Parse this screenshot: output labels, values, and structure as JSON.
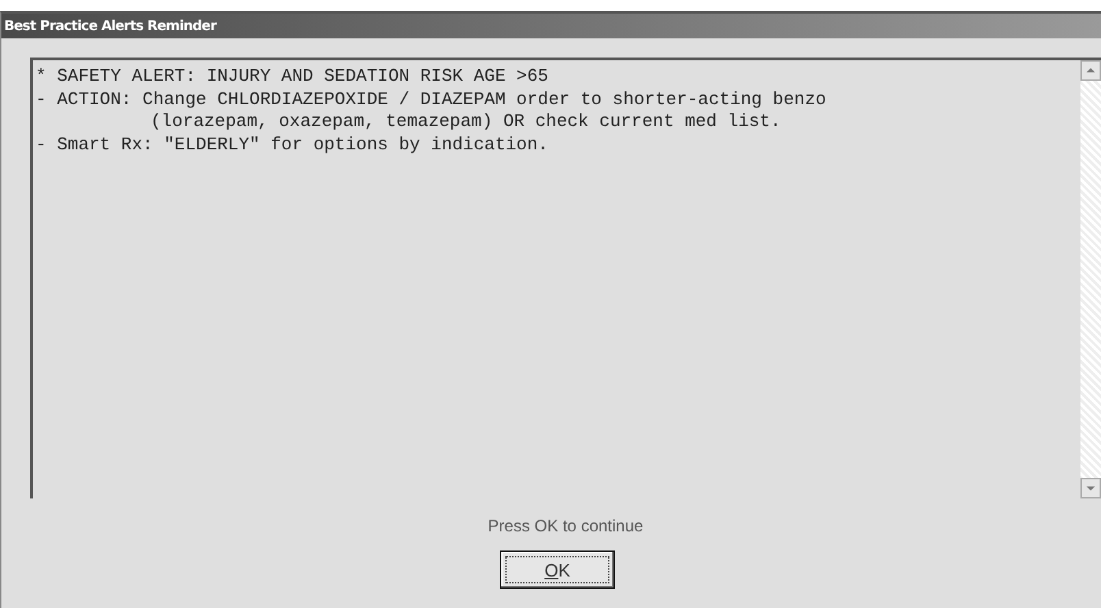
{
  "window": {
    "title": "Best Practice Alerts Reminder"
  },
  "alert_text": [
    {
      "kind": "line",
      "text": "* SAFETY ALERT: INJURY AND SEDATION RISK AGE >65"
    },
    {
      "kind": "line",
      "text": "- ACTION: Change CHLORDIAZEPOXIDE / DIAZEPAM order to shorter-acting benzo"
    },
    {
      "kind": "continuation",
      "text": "(lorazepam, oxazepam, temazepam) OR check current med list."
    },
    {
      "kind": "line",
      "text": "- Smart Rx: \"ELDERLY\" for options by indication."
    }
  ],
  "prompt": "Press OK to continue",
  "buttons": [
    "OK"
  ]
}
